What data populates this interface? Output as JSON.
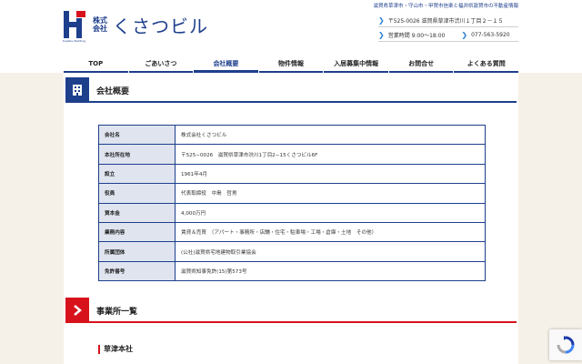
{
  "brand": {
    "kabu_line1": "株式",
    "kabu_line2": "会社",
    "name": "くさつビル",
    "sub": "Kusatsu Building",
    "tagline": "滋賀県草津市・守山市・甲賀市信楽と福井県敦賀市の不動産情報"
  },
  "contact": {
    "address": "〒525-0026 滋賀県草津市渋川１丁目２－１５",
    "hours": "営業時間 9:00～18:00",
    "tel": "077-563-5920"
  },
  "nav": {
    "items": [
      "TOP",
      "ごあいさつ",
      "会社概要",
      "物件情報",
      "入居募集中情報",
      "お問合せ",
      "よくある質問"
    ],
    "active_index": 2
  },
  "section1": {
    "title": "会社概要"
  },
  "company_table": [
    {
      "key": "会社名",
      "value": "株式会社くさつビル"
    },
    {
      "key": "本社所在地",
      "value": "〒525−0026　滋賀県草津市渋川1丁目2−15くさつビル6F"
    },
    {
      "key": "設立",
      "value": "1961年4月"
    },
    {
      "key": "役員",
      "value": "代表取締役　中島　哲男"
    },
    {
      "key": "資本金",
      "value": "4,000万円"
    },
    {
      "key": "業務内容",
      "value": "賃貸＆売買　（アパート・事務所・店舗・住宅・駐車場・工場・倉庫・土地　その他）"
    },
    {
      "key": "所属団体",
      "value": "(公社)滋賀県宅地建物取引業協会"
    },
    {
      "key": "免許番号",
      "value": "滋賀県知事免許(15)第573号"
    }
  ],
  "section2": {
    "title": "事業所一覧"
  },
  "branch": {
    "title": "草津本社"
  },
  "colors": {
    "navy": "#1d3f8c",
    "red": "#d8121b",
    "beige": "#f6f1e8",
    "table_key_bg": "#dfe4ef"
  }
}
